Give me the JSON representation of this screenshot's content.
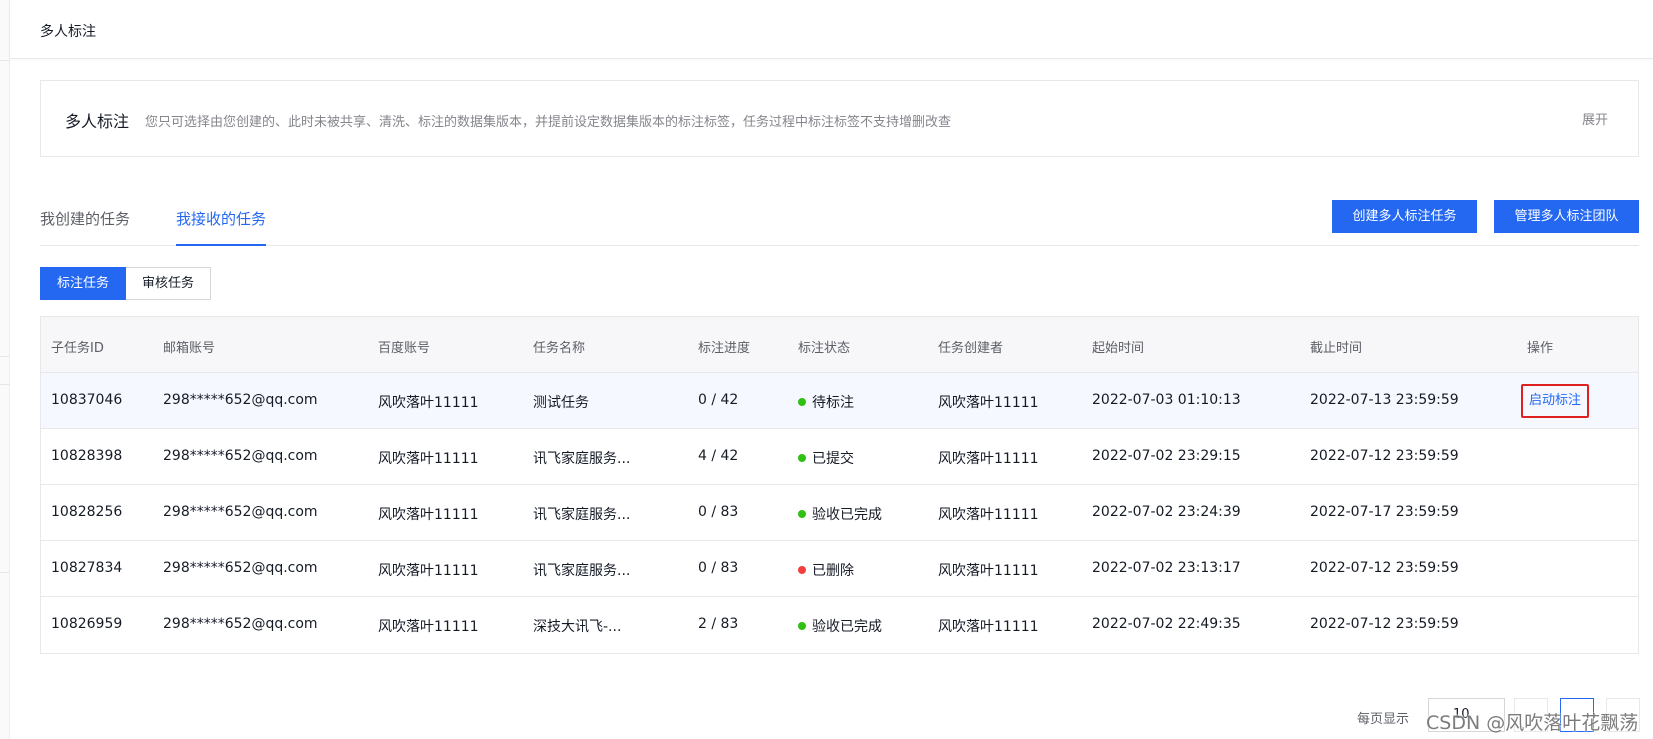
{
  "topbar": {
    "title": "多人标注"
  },
  "intro": {
    "title": "多人标注",
    "description": "您只可选择由您创建的、此时未被共享、清洗、标注的数据集版本，并提前设定数据集版本的标注标签，任务过程中标注标签不支持增删改查",
    "expand_label": "展开"
  },
  "tabs": [
    {
      "label": "我创建的任务"
    },
    {
      "label": "我接收的任务"
    }
  ],
  "buttons": {
    "create": "创建多人标注任务",
    "manage": "管理多人标注团队"
  },
  "segments": [
    {
      "label": "标注任务"
    },
    {
      "label": "审核任务"
    }
  ],
  "table": {
    "headers": [
      "子任务ID",
      "邮箱账号",
      "百度账号",
      "任务名称",
      "标注进度",
      "标注状态",
      "任务创建者",
      "起始时间",
      "截止时间",
      "操作"
    ],
    "rows": [
      {
        "id": "10837046",
        "email": "298*****652@qq.com",
        "baidu": "风吹落叶11111",
        "name": "测试任务",
        "progress": "0 / 42",
        "status": "待标注",
        "status_color": "#30bf13",
        "creator": "风吹落叶11111",
        "start": "2022-07-03 01:10:13",
        "end": "2022-07-13 23:59:59",
        "action": "启动标注"
      },
      {
        "id": "10828398",
        "email": "298*****652@qq.com",
        "baidu": "风吹落叶11111",
        "name": "讯飞家庭服务...",
        "progress": "4 / 42",
        "status": "已提交",
        "status_color": "#30bf13",
        "creator": "风吹落叶11111",
        "start": "2022-07-02 23:29:15",
        "end": "2022-07-12 23:59:59",
        "action": ""
      },
      {
        "id": "10828256",
        "email": "298*****652@qq.com",
        "baidu": "风吹落叶11111",
        "name": "讯飞家庭服务...",
        "progress": "0 / 83",
        "status": "验收已完成",
        "status_color": "#30bf13",
        "creator": "风吹落叶11111",
        "start": "2022-07-02 23:24:39",
        "end": "2022-07-17 23:59:59",
        "action": ""
      },
      {
        "id": "10827834",
        "email": "298*****652@qq.com",
        "baidu": "风吹落叶11111",
        "name": "讯飞家庭服务...",
        "progress": "0 / 83",
        "status": "已删除",
        "status_color": "#f33e3e",
        "creator": "风吹落叶11111",
        "start": "2022-07-02 23:13:17",
        "end": "2022-07-12 23:59:59",
        "action": ""
      },
      {
        "id": "10826959",
        "email": "298*****652@qq.com",
        "baidu": "风吹落叶11111",
        "name": "深技大讯飞-...",
        "progress": "2 / 83",
        "status": "验收已完成",
        "status_color": "#30bf13",
        "creator": "风吹落叶11111",
        "start": "2022-07-02 22:49:35",
        "end": "2022-07-12 23:59:59",
        "action": ""
      }
    ]
  },
  "pagination": {
    "per_page_label": "每页显示",
    "per_page_value": "10"
  },
  "watermark": "CSDN @风吹落叶花飘荡",
  "colors": {
    "accent": "#2468f2",
    "highlight_border": "#e02020"
  }
}
